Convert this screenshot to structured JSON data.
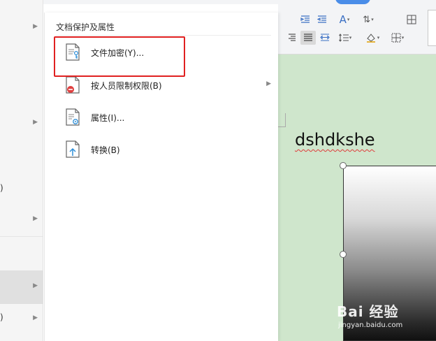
{
  "submenu": {
    "title": "文档保护及属性",
    "items": [
      {
        "label": "文件加密(Y)...",
        "icon": "file-lock-icon",
        "has_submenu": false
      },
      {
        "label": "按人员限制权限(B)",
        "icon": "file-restrict-icon",
        "has_submenu": true
      },
      {
        "label": "属性(I)...",
        "icon": "file-properties-icon",
        "has_submenu": false
      },
      {
        "label": "转换(B)",
        "icon": "file-convert-icon",
        "has_submenu": false
      }
    ]
  },
  "left_menu": {
    "paren_1": ")",
    "paren_2": ")"
  },
  "document": {
    "text": "dshdkshe"
  },
  "watermark": {
    "logo": "Bai 经验",
    "sub": "jingyan.baidu.com"
  },
  "colors": {
    "highlight_border": "#e02020",
    "doc_background": "#cfe6cc",
    "accent": "#4a8de8"
  }
}
